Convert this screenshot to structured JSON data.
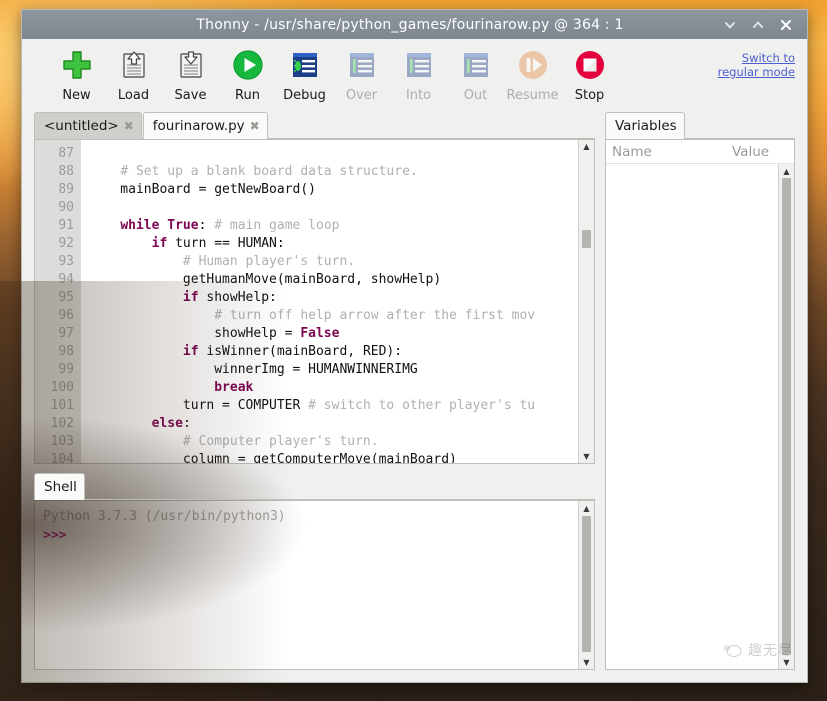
{
  "window": {
    "title": "Thonny  -  /usr/share/python_games/fourinarow.py  @  364 : 1",
    "controls": [
      {
        "name": "minimize-button",
        "glyph": "chevron-down"
      },
      {
        "name": "maximize-button",
        "glyph": "chevron-up"
      },
      {
        "name": "close-button",
        "glyph": "x"
      }
    ]
  },
  "toolbar": {
    "buttons": [
      {
        "label": "New",
        "icon": "new-file-icon",
        "enabled": true
      },
      {
        "label": "Load",
        "icon": "load-icon",
        "enabled": true
      },
      {
        "label": "Save",
        "icon": "save-icon",
        "enabled": true
      },
      {
        "label": "Run",
        "icon": "run-icon",
        "enabled": true
      },
      {
        "label": "Debug",
        "icon": "debug-icon",
        "enabled": true
      },
      {
        "label": "Over",
        "icon": "step-over-icon",
        "enabled": false
      },
      {
        "label": "Into",
        "icon": "step-into-icon",
        "enabled": false
      },
      {
        "label": "Out",
        "icon": "step-out-icon",
        "enabled": false
      },
      {
        "label": "Resume",
        "icon": "resume-icon",
        "enabled": false
      },
      {
        "label": "Stop",
        "icon": "stop-icon",
        "enabled": true
      }
    ],
    "switch_mode_line1": "Switch to",
    "switch_mode_line2": "regular mode"
  },
  "editor": {
    "tabs": [
      {
        "label": "<untitled>",
        "active": false,
        "close": "✖"
      },
      {
        "label": "fourinarow.py",
        "active": true,
        "close": "✖"
      }
    ],
    "first_line_number": 87,
    "line_numbers": [
      "87",
      "88",
      "89",
      "90",
      "91",
      "92",
      "93",
      "94",
      "95",
      "96",
      "97",
      "98",
      "99",
      "100",
      "101",
      "102",
      "103",
      "104"
    ],
    "lines": [
      {
        "n": "87",
        "segments": []
      },
      {
        "n": "88",
        "segments": [
          {
            "t": "    ",
            "c": "txt"
          },
          {
            "t": "# Set up a blank board data structure.",
            "c": "cmt"
          }
        ]
      },
      {
        "n": "89",
        "segments": [
          {
            "t": "    mainBoard = getNewBoard()",
            "c": "txt"
          }
        ]
      },
      {
        "n": "90",
        "segments": []
      },
      {
        "n": "91",
        "segments": [
          {
            "t": "    ",
            "c": "txt"
          },
          {
            "t": "while True",
            "c": "kw"
          },
          {
            "t": ": ",
            "c": "txt"
          },
          {
            "t": "# main game loop",
            "c": "cmt"
          }
        ]
      },
      {
        "n": "92",
        "segments": [
          {
            "t": "        ",
            "c": "txt"
          },
          {
            "t": "if",
            "c": "kw"
          },
          {
            "t": " turn == HUMAN:",
            "c": "txt"
          }
        ]
      },
      {
        "n": "93",
        "segments": [
          {
            "t": "            ",
            "c": "txt"
          },
          {
            "t": "# Human player's turn.",
            "c": "cmt"
          }
        ]
      },
      {
        "n": "94",
        "segments": [
          {
            "t": "            getHumanMove(mainBoard, showHelp)",
            "c": "txt"
          }
        ]
      },
      {
        "n": "95",
        "segments": [
          {
            "t": "            ",
            "c": "txt"
          },
          {
            "t": "if",
            "c": "kw"
          },
          {
            "t": " showHelp:",
            "c": "txt"
          }
        ]
      },
      {
        "n": "96",
        "segments": [
          {
            "t": "                ",
            "c": "txt"
          },
          {
            "t": "# turn off help arrow after the first mov",
            "c": "cmt"
          }
        ]
      },
      {
        "n": "97",
        "segments": [
          {
            "t": "                showHelp = ",
            "c": "txt"
          },
          {
            "t": "False",
            "c": "kw"
          }
        ]
      },
      {
        "n": "98",
        "segments": [
          {
            "t": "            ",
            "c": "txt"
          },
          {
            "t": "if",
            "c": "kw"
          },
          {
            "t": " isWinner(mainBoard, RED):",
            "c": "txt"
          }
        ]
      },
      {
        "n": "99",
        "segments": [
          {
            "t": "                winnerImg = HUMANWINNERIMG",
            "c": "txt"
          }
        ]
      },
      {
        "n": "100",
        "segments": [
          {
            "t": "                ",
            "c": "txt"
          },
          {
            "t": "break",
            "c": "kw"
          }
        ]
      },
      {
        "n": "101",
        "segments": [
          {
            "t": "            turn = COMPUTER ",
            "c": "txt"
          },
          {
            "t": "# switch to other player's tu",
            "c": "cmt"
          }
        ]
      },
      {
        "n": "102",
        "segments": [
          {
            "t": "        ",
            "c": "txt"
          },
          {
            "t": "else",
            "c": "kw"
          },
          {
            "t": ":",
            "c": "txt"
          }
        ]
      },
      {
        "n": "103",
        "segments": [
          {
            "t": "            ",
            "c": "txt"
          },
          {
            "t": "# Computer player's turn.",
            "c": "cmt"
          }
        ]
      },
      {
        "n": "104",
        "segments": [
          {
            "t": "            column = getComputerMove(mainBoard)",
            "c": "txt"
          }
        ]
      }
    ]
  },
  "shell": {
    "tab_label": "Shell",
    "banner": "Python 3.7.3 (/usr/bin/python3)",
    "prompt": ">>>"
  },
  "variables": {
    "tab_label": "Variables",
    "column_name": "Name",
    "column_value": "Value",
    "rows": []
  },
  "watermark": {
    "text": "趣无尽"
  },
  "colors": {
    "titlebar": "#858d96",
    "window_bg": "#f0f0ef",
    "keyword": "#7d0552",
    "comment": "#b0b0b0",
    "prompt": "#b5198b",
    "link": "#4a5fd0",
    "run_green": "#16a34a",
    "stop_red": "#e00040",
    "gutter": "#dcdcda"
  }
}
